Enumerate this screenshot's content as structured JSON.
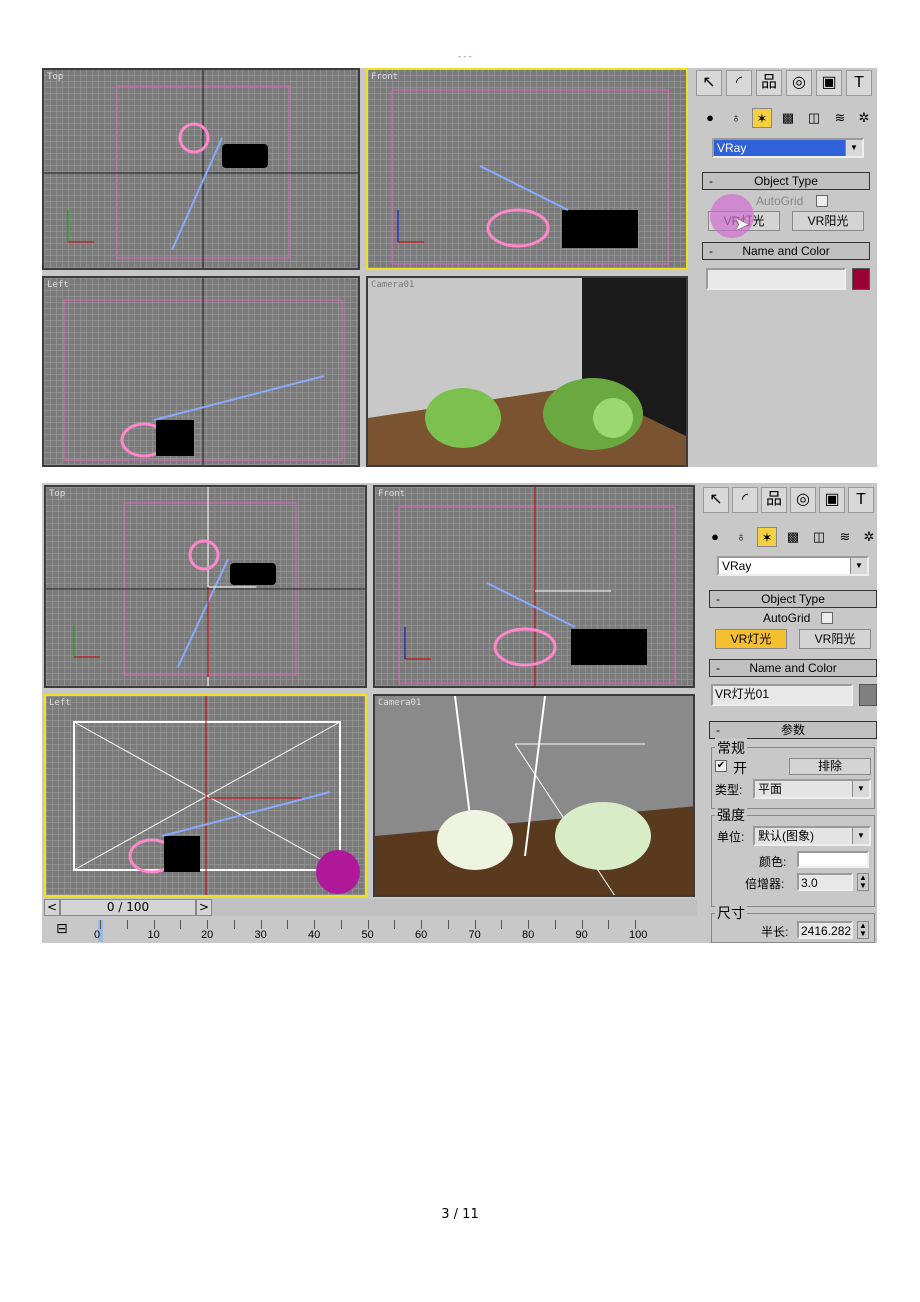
{
  "page_marker": "- - -",
  "footer": {
    "page_number": "3 / 11"
  },
  "colors": {
    "active_viewport": "#f0e020",
    "selected_button": "#f5c030",
    "top_color_swatch": "#990033",
    "bottom_color_swatch": "#808080",
    "teapot_wire": "#ff88cc",
    "light": "#88aaff"
  },
  "screenshot1": {
    "viewports": {
      "top": "Top",
      "front": "Front",
      "left": "Left",
      "camera": "Camera01"
    },
    "panel": {
      "main_tabs": [
        "create-icon",
        "modify-icon",
        "hierarchy-icon",
        "motion-icon",
        "display-icon",
        "utilities-icon"
      ],
      "category_icons": [
        "geometry-icon",
        "shapes-icon",
        "lights-icon",
        "cameras-icon",
        "helpers-icon",
        "spacewarps-icon",
        "systems-icon"
      ],
      "renderer_dropdown": "VRay",
      "object_type": {
        "title": "Object Type",
        "autogrid": "AutoGrid",
        "btn1": "VR灯光",
        "btn2": "VR阳光"
      },
      "name_color": {
        "title": "Name and Color",
        "name": ""
      }
    }
  },
  "screenshot2": {
    "viewports": {
      "top": "Top",
      "front": "Front",
      "left": "Left",
      "camera": "Camera01"
    },
    "panel": {
      "renderer_dropdown": "VRay",
      "object_type": {
        "title": "Object Type",
        "autogrid": "AutoGrid",
        "btn1": "VR灯光",
        "btn2": "VR阳光"
      },
      "name_color": {
        "title": "Name and Color",
        "name": "VR灯光01"
      },
      "params": {
        "title": "参数",
        "general": "常规",
        "on_label": "开",
        "on_checked": true,
        "exclude": "排除",
        "type_label": "类型:",
        "type_value": "平面",
        "intensity": "强度",
        "units_label": "单位:",
        "units_value": "默认(图象)",
        "color_label": "颜色:",
        "multiplier_label": "倍增器:",
        "multiplier_value": "3.0",
        "size": "尺寸",
        "half_length_label": "半长:",
        "half_length_value": "2416.282"
      }
    },
    "time_slider": {
      "value": "0 / 100",
      "prev": "<",
      "next": ">"
    },
    "track_bar": {
      "ticks": [
        "0",
        "10",
        "20",
        "30",
        "40",
        "50",
        "60",
        "70",
        "80",
        "90",
        "100"
      ]
    }
  }
}
